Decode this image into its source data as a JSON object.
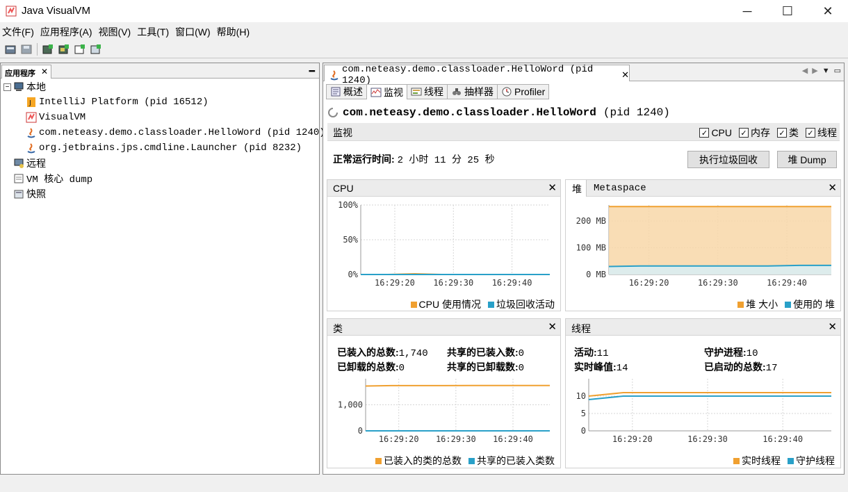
{
  "window": {
    "title": "Java VisualVM",
    "minimize": "─",
    "maximize": "☐",
    "close": "✕"
  },
  "menu": [
    "文件(F)",
    "应用程序(A)",
    "视图(V)",
    "工具(T)",
    "窗口(W)",
    "帮助(H)"
  ],
  "left": {
    "tab_label": "应用程序",
    "tree": {
      "local": "本地",
      "local_children": [
        "IntelliJ Platform (pid 16512)",
        "VisualVM",
        "com.neteasy.demo.classloader.HelloWord (pid 1240)",
        "org.jetbrains.jps.cmdline.Launcher (pid 8232)"
      ],
      "remote": "远程",
      "core_dump": "VM 核心 dump",
      "snapshots": "快照"
    }
  },
  "doc": {
    "tab_label": "com.neteasy.demo.classloader.HelloWord (pid 1240)",
    "subtabs": [
      "概述",
      "监视",
      "线程",
      "抽样器",
      "Profiler"
    ],
    "heading_name": "com.neteasy.demo.classloader.HelloWord",
    "heading_pid": "(pid 1240)",
    "monitor_title": "监视",
    "checkboxes": [
      "CPU",
      "内存",
      "类",
      "线程"
    ],
    "uptime_label": "正常运行时间:",
    "uptime_value": "2 小时 11 分 25 秒",
    "gc_button": "执行垃圾回收",
    "heap_dump_button": "堆 Dump"
  },
  "cards": {
    "cpu": {
      "title": "CPU",
      "legend": [
        "CPU 使用情况",
        "垃圾回收活动"
      ]
    },
    "heap": {
      "tab_active": "堆",
      "tab_other": "Metaspace",
      "legend": [
        "堆 大小",
        "使用的 堆"
      ]
    },
    "classes": {
      "title": "类",
      "stats": [
        {
          "label": "已装入的总数:",
          "value": "1,740"
        },
        {
          "label": "共享的已装入数:",
          "value": "0"
        },
        {
          "label": "已卸载的总数:",
          "value": "0"
        },
        {
          "label": "共享的已卸载数:",
          "value": "0"
        }
      ],
      "legend": [
        "已装入的类的总数",
        "共享的已装入类数"
      ]
    },
    "threads": {
      "title": "线程",
      "stats": [
        {
          "label": "活动:",
          "value": "11"
        },
        {
          "label": "守护进程:",
          "value": "10"
        },
        {
          "label": "实时峰值:",
          "value": "14"
        },
        {
          "label": "已启动的总数:",
          "value": "17"
        }
      ],
      "legend": [
        "实时线程",
        "守护线程"
      ]
    }
  },
  "colors": {
    "series_orange": "#f0a030",
    "series_blue": "#29a0c8",
    "accent_fill": "#f8d7a8"
  },
  "chart_data": [
    {
      "type": "line",
      "title": "CPU",
      "x_ticks": [
        "16:29:20",
        "16:29:30",
        "16:29:40"
      ],
      "y_ticks": [
        "0%",
        "50%",
        "100%"
      ],
      "ylim": [
        0,
        100
      ],
      "series": [
        {
          "name": "CPU 使用情况",
          "values": [
            0,
            0,
            1,
            0,
            0,
            0,
            0,
            0
          ]
        },
        {
          "name": "垃圾回收活动",
          "values": [
            0,
            0,
            0,
            0,
            0,
            0,
            0,
            0
          ]
        }
      ]
    },
    {
      "type": "area",
      "title": "堆",
      "x_ticks": [
        "16:29:20",
        "16:29:30",
        "16:29:40"
      ],
      "y_ticks": [
        "0 MB",
        "100 MB",
        "200 MB"
      ],
      "ylim": [
        0,
        260
      ],
      "series": [
        {
          "name": "堆 大小",
          "values": [
            254,
            254,
            254,
            254,
            254,
            254,
            254,
            254
          ]
        },
        {
          "name": "使用的 堆",
          "values": [
            30,
            32,
            32,
            32,
            32,
            32,
            34,
            34
          ]
        }
      ]
    },
    {
      "type": "line",
      "title": "类",
      "x_ticks": [
        "16:29:20",
        "16:29:30",
        "16:29:40"
      ],
      "y_ticks": [
        "0",
        "1,000"
      ],
      "ylim": [
        0,
        2000
      ],
      "series": [
        {
          "name": "已装入的类的总数",
          "values": [
            1720,
            1735,
            1735,
            1735,
            1740,
            1740,
            1740,
            1740
          ]
        },
        {
          "name": "共享的已装入类数",
          "values": [
            0,
            0,
            0,
            0,
            0,
            0,
            0,
            0
          ]
        }
      ]
    },
    {
      "type": "line",
      "title": "线程",
      "x_ticks": [
        "16:29:20",
        "16:29:30",
        "16:29:40"
      ],
      "y_ticks": [
        "0",
        "5",
        "10"
      ],
      "ylim": [
        0,
        15
      ],
      "series": [
        {
          "name": "实时线程",
          "values": [
            10,
            11,
            11,
            11,
            11,
            11,
            11,
            11
          ]
        },
        {
          "name": "守护线程",
          "values": [
            9,
            10,
            10,
            10,
            10,
            10,
            10,
            10
          ]
        }
      ]
    }
  ]
}
